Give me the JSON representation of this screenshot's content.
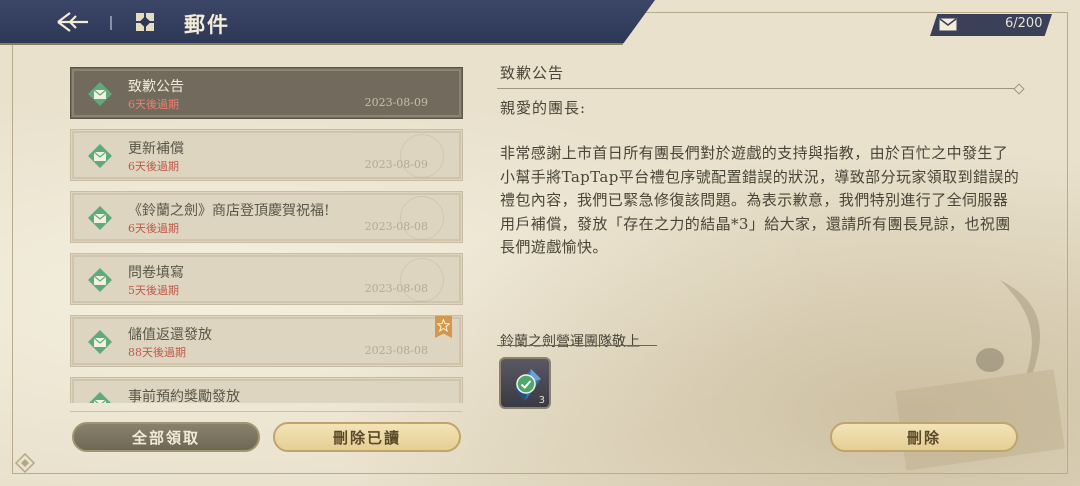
{
  "header": {
    "title": "郵件",
    "mail_count": "6/200"
  },
  "mail_list": [
    {
      "title": "致歉公告",
      "expire": "6天後過期",
      "date": "2023-08-09",
      "selected": true
    },
    {
      "title": "更新補償",
      "expire": "6天後過期",
      "date": "2023-08-09"
    },
    {
      "title": "《鈴蘭之劍》商店登頂慶賀祝福!",
      "expire": "6天後過期",
      "date": "2023-08-08"
    },
    {
      "title": "問卷填寫",
      "expire": "5天後過期",
      "date": "2023-08-08"
    },
    {
      "title": "儲值返還發放",
      "expire": "88天後過期",
      "date": "2023-08-08",
      "starred": true
    },
    {
      "title": "事前預約獎勵發放",
      "expire": "",
      "date": ""
    }
  ],
  "buttons": {
    "claim_all": "全部領取",
    "delete_read": "刪除已讀",
    "delete": "刪除"
  },
  "content": {
    "title": "致歉公告",
    "greeting": "親愛的團長:",
    "body": "非常感謝上市首日所有團長們對於遊戲的支持與指教，由於百忙之中發生了小幫手將TapTap平台禮包序號配置錯誤的狀況，導致部分玩家領取到錯誤的禮包內容，我們已緊急修復該問題。為表示歉意，我們特別進行了全伺服器用戶補償，發放「存在之力的結晶*3」給大家，還請所有團長見諒，也祝團長們遊戲愉快。",
    "sender": "鈴蘭之劍營運團隊敬上",
    "attachment": {
      "qty": "3",
      "icon": "crystal-icon",
      "claimed": true
    }
  },
  "colors": {
    "header_bg": "#2d3756",
    "selected_item": "#726a5c",
    "expire_text": "#c0594a",
    "button_gold": "#e4cf93"
  }
}
